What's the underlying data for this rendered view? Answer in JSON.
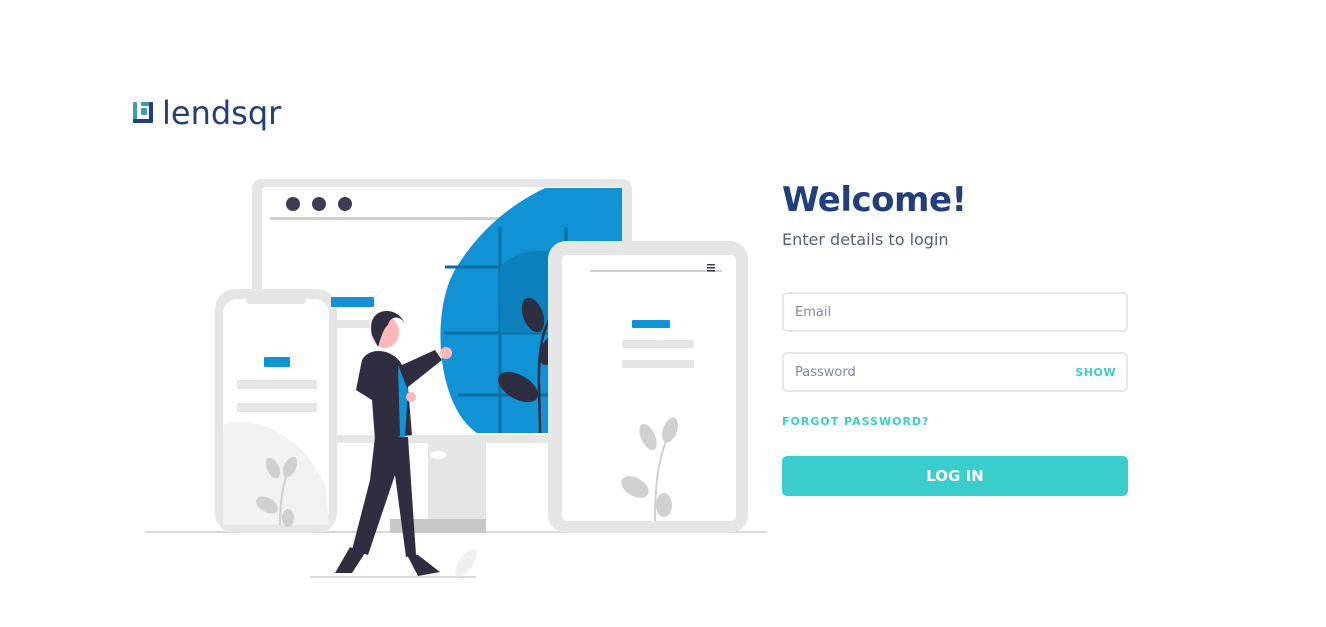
{
  "brand": {
    "logo_text": "lendsqr",
    "logo_icon": "lendsqr-logo-icon",
    "color": "#213F7D"
  },
  "login": {
    "title": "Welcome!",
    "subtitle": "Enter details to login",
    "email_placeholder": "Email",
    "password_placeholder": "Password",
    "show_label": "SHOW",
    "forgot_label": "FORGOT PASSWORD?",
    "submit_label": "LOG IN"
  },
  "colors": {
    "primary": "#213F7D",
    "accent": "#39CDCC",
    "illustration_blue": "#1092D4",
    "figure_dark": "#2F2E41"
  },
  "illustration": {
    "icon": "woman-with-devices-illustration"
  }
}
